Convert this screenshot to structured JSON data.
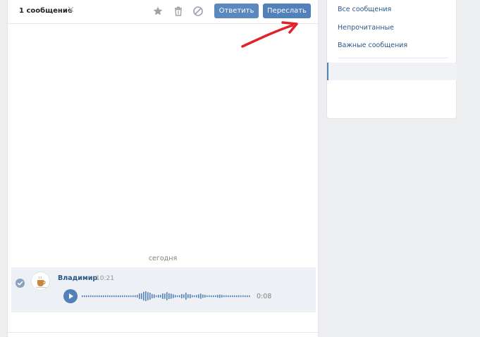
{
  "toolbar": {
    "selection_count": "1 сообщение",
    "clear_glyph": "✕",
    "icons": [
      "star-icon",
      "trash-icon",
      "block-icon"
    ],
    "reply_label": "Ответить",
    "forward_label": "Переслать"
  },
  "conversation": {
    "date_separator": "сегодня",
    "message": {
      "author": "Владимир",
      "time": "10:21",
      "selected": true,
      "voice": {
        "duration": "0:08"
      }
    }
  },
  "sidebar": {
    "items": [
      {
        "label": "Все сообщения"
      },
      {
        "label": "Непрочитанные"
      },
      {
        "label": "Важные сообщения"
      }
    ]
  },
  "colors": {
    "accent": "#5181b8",
    "link": "#2a5885",
    "annotation_arrow": "#e0242a"
  }
}
